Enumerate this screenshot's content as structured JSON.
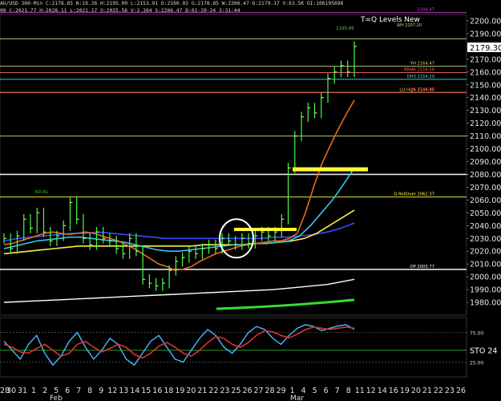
{
  "header": {
    "line1": "AU/USD  360-Min  C:2178.85  N:19.26  H:2195.00  L:2153.91  O:2160.02  G:2178.85  W:2206.47  O:2179.17  V:63.5K  OI:106195696",
    "line2": "00  C:2021.77  H:2028.11  L:2021.17  O:2025.56  V:2,364  S:2206.47  D:01-29-24  3:31:44"
  },
  "chart_data": {
    "type": "line",
    "title": "T=Q Levels New",
    "ylim": [
      1970,
      2205
    ],
    "y_ticks": [
      1980,
      1990,
      2000,
      2010,
      2020,
      2030,
      2040,
      2050,
      2060,
      2070,
      2080,
      2090,
      2100,
      2110,
      2120,
      2130,
      2140,
      2150,
      2160,
      2170,
      2180,
      2190,
      2200
    ],
    "last_price": "2179.30",
    "x_ticks": [
      "2628",
      "30",
      "31",
      "1",
      "2",
      "5",
      "6",
      "7",
      "8",
      "9",
      "12",
      "13",
      "14",
      "15",
      "16",
      "18",
      "19",
      "20",
      "21",
      "22",
      "23",
      "25",
      "26",
      "27",
      "28",
      "29",
      "1",
      "4",
      "5",
      "6",
      "7",
      "8",
      "11",
      "12",
      "14",
      "16",
      "19",
      "20",
      "21",
      "22",
      "23",
      "26"
    ],
    "month_labels": [
      "Feb",
      "Mar"
    ],
    "price_points": [
      2030,
      2022,
      2032,
      2045,
      2038,
      2050,
      2035,
      2028,
      2032,
      2040,
      2058,
      2045,
      2030,
      2025,
      2035,
      2030,
      2028,
      2022,
      2018,
      2030,
      2020,
      1998,
      1995,
      1993,
      1995,
      2005,
      2012,
      2015,
      2020,
      2018,
      2022,
      2025,
      2022,
      2030,
      2028,
      2025,
      2030,
      2026,
      2032,
      2035,
      2032,
      2035,
      2045,
      2085,
      2110,
      2125,
      2132,
      2128,
      2140,
      2155,
      2160,
      2165,
      2160,
      2180
    ],
    "ema_fast": [
      2025,
      2026,
      2028,
      2030,
      2032,
      2034,
      2035,
      2034,
      2033,
      2034,
      2035,
      2034,
      2032,
      2030,
      2028,
      2025,
      2022,
      2018,
      2014,
      2010,
      2008,
      2005,
      2006,
      2008,
      2012,
      2015,
      2018,
      2020,
      2022,
      2024,
      2025,
      2026,
      2027,
      2028,
      2028,
      2030,
      2034,
      2050,
      2070,
      2088,
      2102,
      2115,
      2127,
      2138
    ],
    "ema_mid": [
      2022,
      2024,
      2026,
      2028,
      2029,
      2030,
      2031,
      2031,
      2030,
      2029,
      2028,
      2027,
      2025,
      2023,
      2021,
      2020,
      2020,
      2021,
      2022,
      2023,
      2024,
      2025,
      2025,
      2026,
      2026,
      2027,
      2028,
      2032,
      2040,
      2050,
      2060,
      2072,
      2085
    ],
    "ema_slow_yellow": [
      2018,
      2019,
      2020,
      2021,
      2022,
      2023,
      2024,
      2024,
      2024,
      2024,
      2024,
      2024,
      2024,
      2024,
      2024,
      2024,
      2025,
      2025,
      2025,
      2025,
      2026,
      2026,
      2027,
      2028,
      2030,
      2034,
      2040,
      2046,
      2052
    ],
    "ema_slow_blue": [
      2028,
      2030,
      2031,
      2032,
      2033,
      2034,
      2034,
      2035,
      2034,
      2033,
      2032,
      2031,
      2030,
      2030,
      2030,
      2030,
      2030,
      2030,
      2030,
      2030,
      2031,
      2031,
      2032,
      2033,
      2035,
      2038,
      2042
    ],
    "ema_white": [
      1980,
      1981,
      1982,
      1983,
      1984,
      1985,
      1986,
      1987,
      1988,
      1989,
      1990,
      1992,
      1994,
      1998
    ],
    "hlines": [
      {
        "price": 2206.47,
        "color": "#d040d0",
        "label": "2206.47"
      },
      {
        "price": 2186,
        "color": "#d4d47a",
        "label": ""
      },
      {
        "price": 2164.47,
        "color": "#d4d47a",
        "label": "YH 2164.47"
      },
      {
        "price": 2159.59,
        "color": "#ff6666",
        "label": "RRHR 2159.59"
      },
      {
        "price": 2154.29,
        "color": "#40e0e0",
        "label": "DH3 2154.29"
      },
      {
        "price": 2144.0,
        "color": "#d4d47a",
        "label": "LQ High 2144.00"
      },
      {
        "price": 2144.1,
        "color": "#ff4040",
        "label": "YL 2144.10"
      },
      {
        "price": 2110,
        "color": "#d4d47a",
        "label": ""
      },
      {
        "price": 2080,
        "color": "#ffffff",
        "label": ""
      },
      {
        "price": 2062.37,
        "color": "#ffff40",
        "label": "Q RollOver 2062.37"
      },
      {
        "price": 2005.77,
        "color": "#ffffff",
        "label": "DP 2005.77"
      }
    ],
    "annotations": {
      "wk_high": "WH 2207.20",
      "peak": "2195.86",
      "early_high": "60.91"
    },
    "oscillator": {
      "name": "STO",
      "readout": "24",
      "levels": [
        "75.00",
        "25.00"
      ],
      "k_line": [
        60,
        45,
        30,
        55,
        70,
        40,
        20,
        35,
        60,
        75,
        50,
        30,
        45,
        65,
        55,
        30,
        20,
        40,
        60,
        70,
        50,
        30,
        25,
        45,
        65,
        80,
        70,
        50,
        40,
        55,
        75,
        85,
        80,
        65,
        55,
        70,
        82,
        88,
        85,
        78,
        82,
        86,
        88,
        80
      ],
      "d_line": [
        55,
        50,
        42,
        40,
        48,
        55,
        45,
        35,
        40,
        55,
        60,
        50,
        42,
        48,
        55,
        50,
        38,
        32,
        40,
        52,
        58,
        50,
        40,
        35,
        45,
        58,
        68,
        65,
        55,
        50,
        58,
        70,
        78,
        76,
        70,
        66,
        72,
        80,
        84,
        82,
        80,
        82,
        84,
        82
      ]
    }
  }
}
